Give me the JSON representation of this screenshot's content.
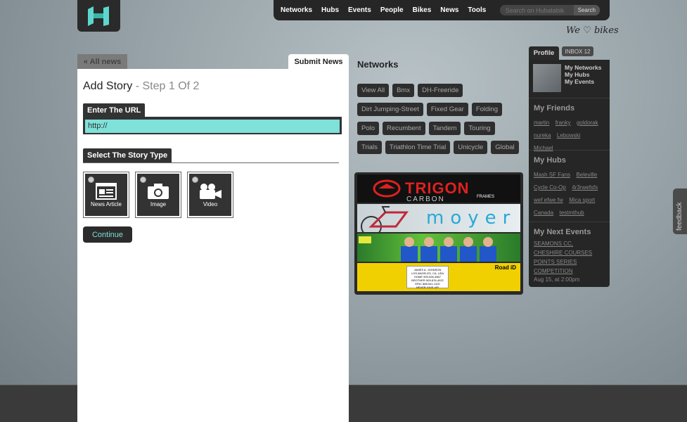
{
  "nav": {
    "items": [
      "Networks",
      "Hubs",
      "Events",
      "People",
      "Bikes",
      "News",
      "Tools"
    ],
    "search_placeholder": "Search on Hubalabik",
    "search_button": "Search"
  },
  "tagline": {
    "prefix": "We",
    "suffix": "bikes"
  },
  "tabs": {
    "all_news": "« All news",
    "submit_news": "Submit News"
  },
  "form": {
    "title": "Add Story",
    "step": "- Step 1 Of 2",
    "url_label": "Enter The URL",
    "url_value": "http://",
    "type_label": "Select The Story Type",
    "types": [
      {
        "label": "News Article"
      },
      {
        "label": "Image"
      },
      {
        "label": "Video"
      }
    ],
    "continue": "Continue"
  },
  "networks": {
    "title": "Networks",
    "tags": [
      "View All",
      "Bmx",
      "DH-Freeride",
      "Dirt Jumping-Street",
      "Fixed Gear",
      "Folding",
      "Polo",
      "Recumbent",
      "Tandem",
      "Touring",
      "Trials",
      "Triathlon Time Trial",
      "Unicycle",
      "Global"
    ]
  },
  "ads": {
    "trigon": {
      "title": "TRIGON",
      "sub": "CARBON",
      "frames": "FRAMES"
    },
    "moyer": {
      "title": "moyer"
    },
    "road": {
      "card_lines": [
        "JAMES A. JOHNSON",
        "LOS ANGELES, CA, USA",
        "HOME 909-526-4567",
        "BROTHER 909-876-4022",
        "ERIC 888-541-1102",
        "NEVER GIVE UP!"
      ],
      "brand": "Road iD"
    }
  },
  "sidebar": {
    "profile_tab": "Profile",
    "inbox_tab": "INBOX 12",
    "profile_links": [
      "My Networks",
      "My Hubs",
      "My Events"
    ],
    "friends_title": "My Friends",
    "friends": [
      "martin",
      "franky",
      "goldorak",
      "nureka",
      "Lebowski",
      "Michael"
    ],
    "hubs_title": "My Hubs",
    "hubs": [
      "Mash SF Fans",
      "Beleville Cycle Co-Op",
      "4r3rwefsfs",
      "wef efwe fw",
      "Mica sport Canada",
      "testmthub"
    ],
    "events_title": "My Next Events",
    "event_link": "SEAMONS CC, CHESHIRE COURSES POINTS SERIES COMPETITION",
    "event_date": "Aug 15, at 2:00pm"
  },
  "feedback": "feedback",
  "colors": {
    "accent": "#7ee1da",
    "dark": "#2b2b2b",
    "trigon_red": "#e0201e",
    "moyer_blue": "#29a9d8"
  }
}
